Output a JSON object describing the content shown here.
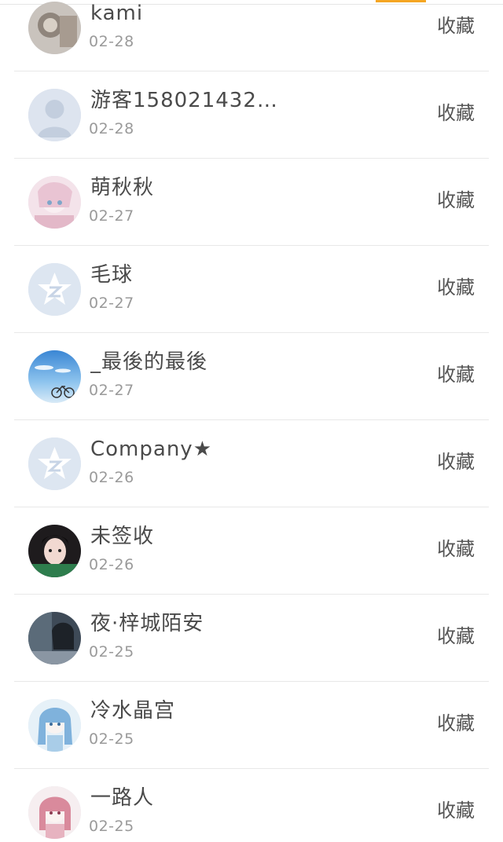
{
  "items": [
    {
      "name": "kami",
      "date": "02-28",
      "action": "收藏",
      "avatar": "photo-avatar"
    },
    {
      "name": "游客158021432…",
      "date": "02-28",
      "action": "收藏",
      "avatar": "default-person-avatar"
    },
    {
      "name": "萌秋秋",
      "date": "02-27",
      "action": "收藏",
      "avatar": "anime-avatar"
    },
    {
      "name": "毛球",
      "date": "02-27",
      "action": "收藏",
      "avatar": "qzone-star-avatar"
    },
    {
      "name": "_最後的最後",
      "date": "02-27",
      "action": "收藏",
      "avatar": "sky-bicycle-avatar"
    },
    {
      "name": "Company★",
      "date": "02-26",
      "action": "收藏",
      "avatar": "qzone-star-avatar"
    },
    {
      "name": "未签收",
      "date": "02-26",
      "action": "收藏",
      "avatar": "girl-photo-avatar"
    },
    {
      "name": "夜·梓城陌安",
      "date": "02-25",
      "action": "收藏",
      "avatar": "dark-photo-avatar"
    },
    {
      "name": "冷水晶宫",
      "date": "02-25",
      "action": "收藏",
      "avatar": "anime-blue-avatar"
    },
    {
      "name": "一路人",
      "date": "02-25",
      "action": "收藏",
      "avatar": "anime-pink-avatar"
    }
  ],
  "colors": {
    "accent": "#f5a623",
    "name_text": "#4a4a4a",
    "date_text": "#9a9a9a",
    "divider": "#e8e8e8"
  }
}
